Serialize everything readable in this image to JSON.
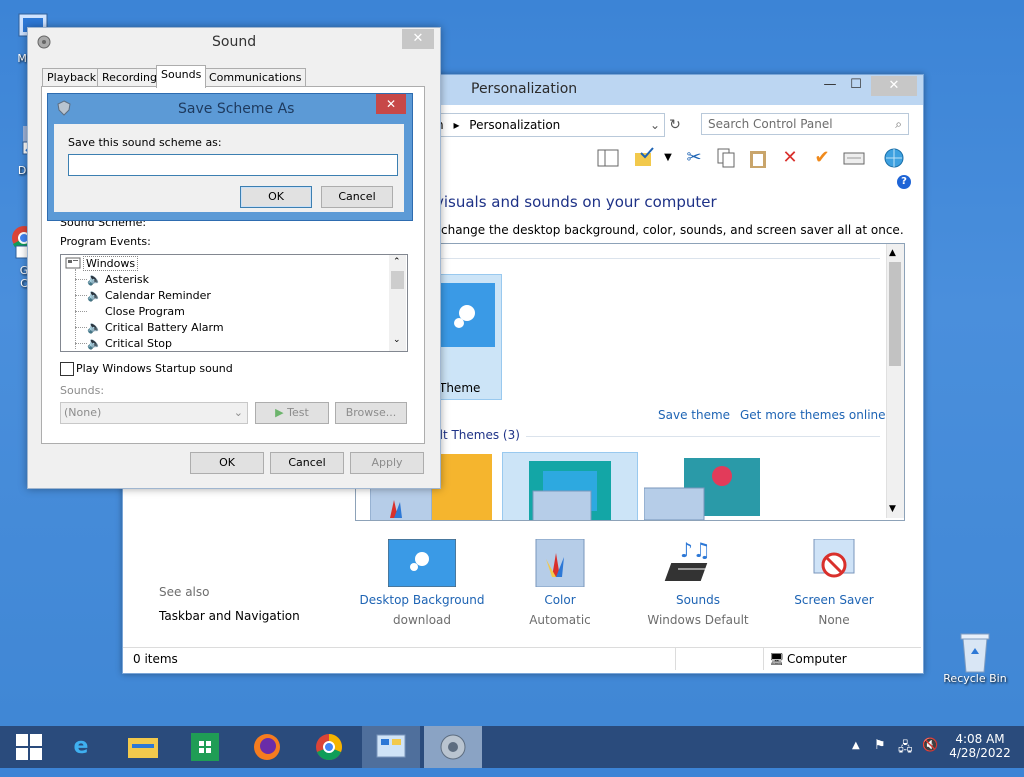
{
  "desktop": {
    "icons": [
      {
        "label": "My C",
        "icon": "computer-icon"
      },
      {
        "label": "Data",
        "icon": "shortcut-icon"
      },
      {
        "label": "G",
        "icon": "chrome-shortcut-icon"
      },
      {
        "label": "C",
        "icon": "chrome-shortcut-icon"
      },
      {
        "label": "Recycle Bin",
        "icon": "recycle-bin-icon"
      }
    ]
  },
  "personalization": {
    "title": "Personalization",
    "address": {
      "prefix": "n",
      "separator": "▸",
      "current": "Personalization"
    },
    "search_placeholder": "Search Control Panel",
    "heading": "visuals and sounds on your computer",
    "subheading": "change the desktop background, color, sounds, and screen saver all at once.",
    "group1_label": ")",
    "selected_theme_label": "Theme",
    "save_theme_link": "Save theme",
    "more_themes_link": "Get more themes online",
    "group2_label": "ult Themes (3)",
    "bottom_items": [
      {
        "label": "Desktop Background",
        "sub": "download",
        "icon": "desktop-background-icon"
      },
      {
        "label": "Color",
        "sub": "Automatic",
        "icon": "color-icon"
      },
      {
        "label": "Sounds",
        "sub": "Windows Default",
        "icon": "sounds-icon"
      },
      {
        "label": "Screen Saver",
        "sub": "None",
        "icon": "screen-saver-icon"
      }
    ],
    "see_also": "See also",
    "see_also_link": "Taskbar and Navigation",
    "status_items": "0 items",
    "status_computer": "Computer"
  },
  "sound_dialog": {
    "title": "Sound",
    "tabs": [
      "Playback",
      "Recording",
      "Sounds",
      "Communications"
    ],
    "active_tab": "Sounds",
    "sound_scheme_label": "Sound Scheme:",
    "program_events_label": "Program Events:",
    "events": [
      {
        "label": "Windows",
        "has_speaker": false,
        "root": true
      },
      {
        "label": "Asterisk",
        "has_speaker": true
      },
      {
        "label": "Calendar Reminder",
        "has_speaker": true
      },
      {
        "label": "Close Program",
        "has_speaker": false
      },
      {
        "label": "Critical Battery Alarm",
        "has_speaker": true
      },
      {
        "label": "Critical Stop",
        "has_speaker": true
      }
    ],
    "startup_checkbox_label": "Play Windows Startup sound",
    "startup_checked": false,
    "sounds_label": "Sounds:",
    "sounds_value": "(None)",
    "test_button": "Test",
    "browse_button": "Browse...",
    "ok_button": "OK",
    "cancel_button": "Cancel",
    "apply_button": "Apply"
  },
  "save_scheme": {
    "title": "Save Scheme As",
    "prompt": "Save this sound scheme as:",
    "input_value": "",
    "ok_button": "OK",
    "cancel_button": "Cancel",
    "close_glyph": "✕"
  },
  "taskbar": {
    "time": "4:08 AM",
    "date": "4/28/2022",
    "items": [
      "start-icon",
      "ie-icon",
      "explorer-icon",
      "store-icon",
      "firefox-icon",
      "chrome-icon",
      "control-panel-icon",
      "sound-icon"
    ]
  },
  "colors": {
    "accent": "#5c9ad6",
    "link": "#1e64b4",
    "taskbar": "#2a4b7c",
    "desktop": "#4a8fdc"
  }
}
